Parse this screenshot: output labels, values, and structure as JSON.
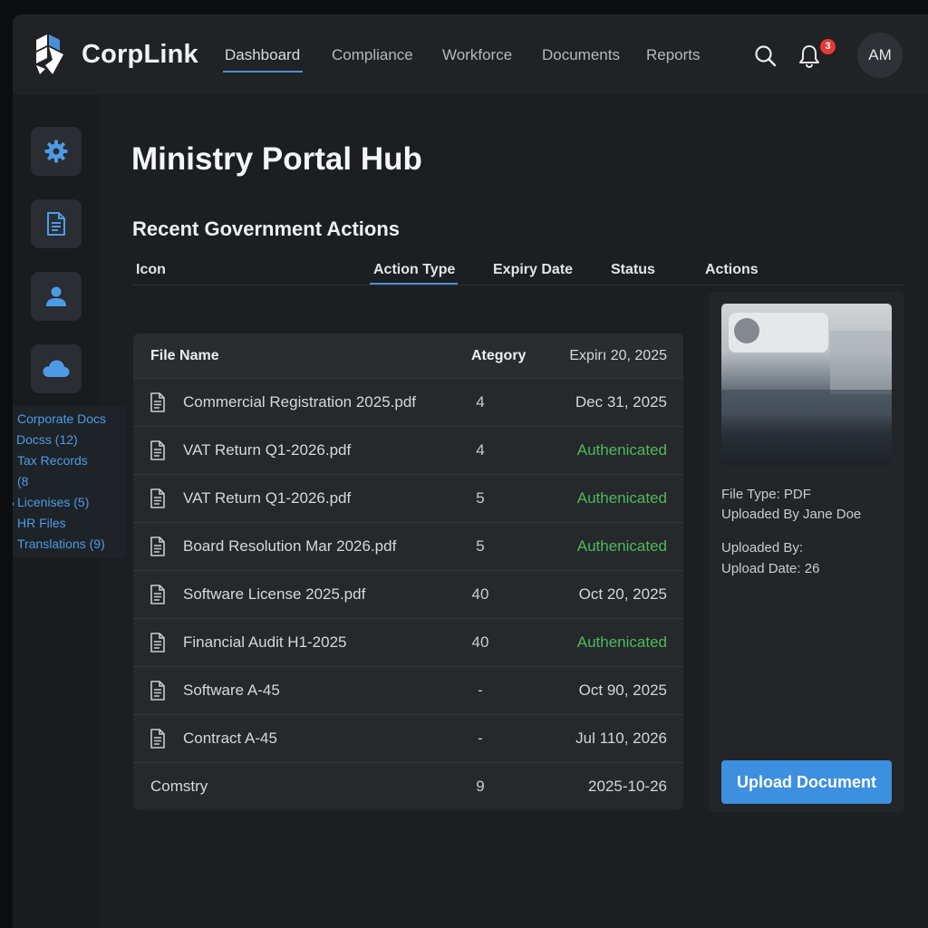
{
  "header": {
    "brand": "CorpLink",
    "nav": [
      {
        "label": "Dashboard",
        "active": true
      },
      {
        "label": "Compliance"
      },
      {
        "label": "Workforce"
      },
      {
        "label": "Documents"
      },
      {
        "label": "Reports"
      }
    ],
    "notification_count": "3",
    "avatar_initials": "AM"
  },
  "sidebar": {
    "buttons": [
      "gear-icon",
      "document-icon",
      "user-icon",
      "cloud-icon"
    ],
    "folders": [
      {
        "icon": "list-icon",
        "label": "Corporate Docs"
      },
      {
        "icon": "",
        "label": "Docss (12)"
      },
      {
        "icon": "bag-icon",
        "label": "Tax Records"
      },
      {
        "icon": "calendar-icon",
        "label": "(8"
      },
      {
        "icon": "folder-icon",
        "label": "Licenises (5)"
      },
      {
        "icon": "users-icon",
        "label": "HR Files"
      },
      {
        "icon": "gear-icon",
        "label": "Translations (9)"
      }
    ]
  },
  "main": {
    "title": "Ministry Portal Hub",
    "section_title": "Recent Government Actions",
    "columns": [
      "Icon",
      "Action Type",
      "Expiry Date",
      "Status",
      "Actions"
    ],
    "active_column": "Action Type"
  },
  "table": {
    "headers": {
      "file_name": "File Name",
      "category": "Ategory",
      "expiry": "Expirı 20, 2025"
    },
    "rows": [
      {
        "name": "Commercial Registration 2025.pdf",
        "category": "4",
        "expiry": "Dec 31, 2025",
        "icon": true
      },
      {
        "name": "VAT Return Q1-2026.pdf",
        "category": "4",
        "expiry": "Authenicated",
        "status": "ok",
        "icon": true
      },
      {
        "name": "VAT Return Q1-2026.pdf",
        "category": "5",
        "expiry": "Authenicated",
        "status": "ok",
        "icon": true
      },
      {
        "name": "Board Resolution Mar 2026.pdf",
        "category": "5",
        "expiry": "Authenicated",
        "status": "ok",
        "icon": true
      },
      {
        "name": "Software License 2025.pdf",
        "category": "40",
        "expiry": "Oct 20, 2025",
        "icon": true
      },
      {
        "name": "Financial Audit H1-2025",
        "category": "40",
        "expiry": "Authenicated",
        "status": "ok",
        "icon": true
      },
      {
        "name": "Software A-45",
        "category": "-",
        "expiry": "Oct 90, 2025",
        "icon": true
      },
      {
        "name": "Contract A-45",
        "category": "-",
        "expiry": "Jul 110, 2026",
        "icon": true
      },
      {
        "name": "Comstry",
        "category": "9",
        "expiry": "2025-10-26",
        "icon": false
      }
    ]
  },
  "details": {
    "file_type": "File Type: PDF",
    "uploaded_by_name": "Uploaded By Jane Doe",
    "uploaded_by": "Uploaded By:",
    "upload_date": "Upload Date: 26",
    "upload_button": "Upload Document"
  },
  "colors": {
    "accent": "#3d8fe0",
    "success": "#4cbb5a",
    "badge": "#e53935",
    "background": "#1c1e21"
  }
}
